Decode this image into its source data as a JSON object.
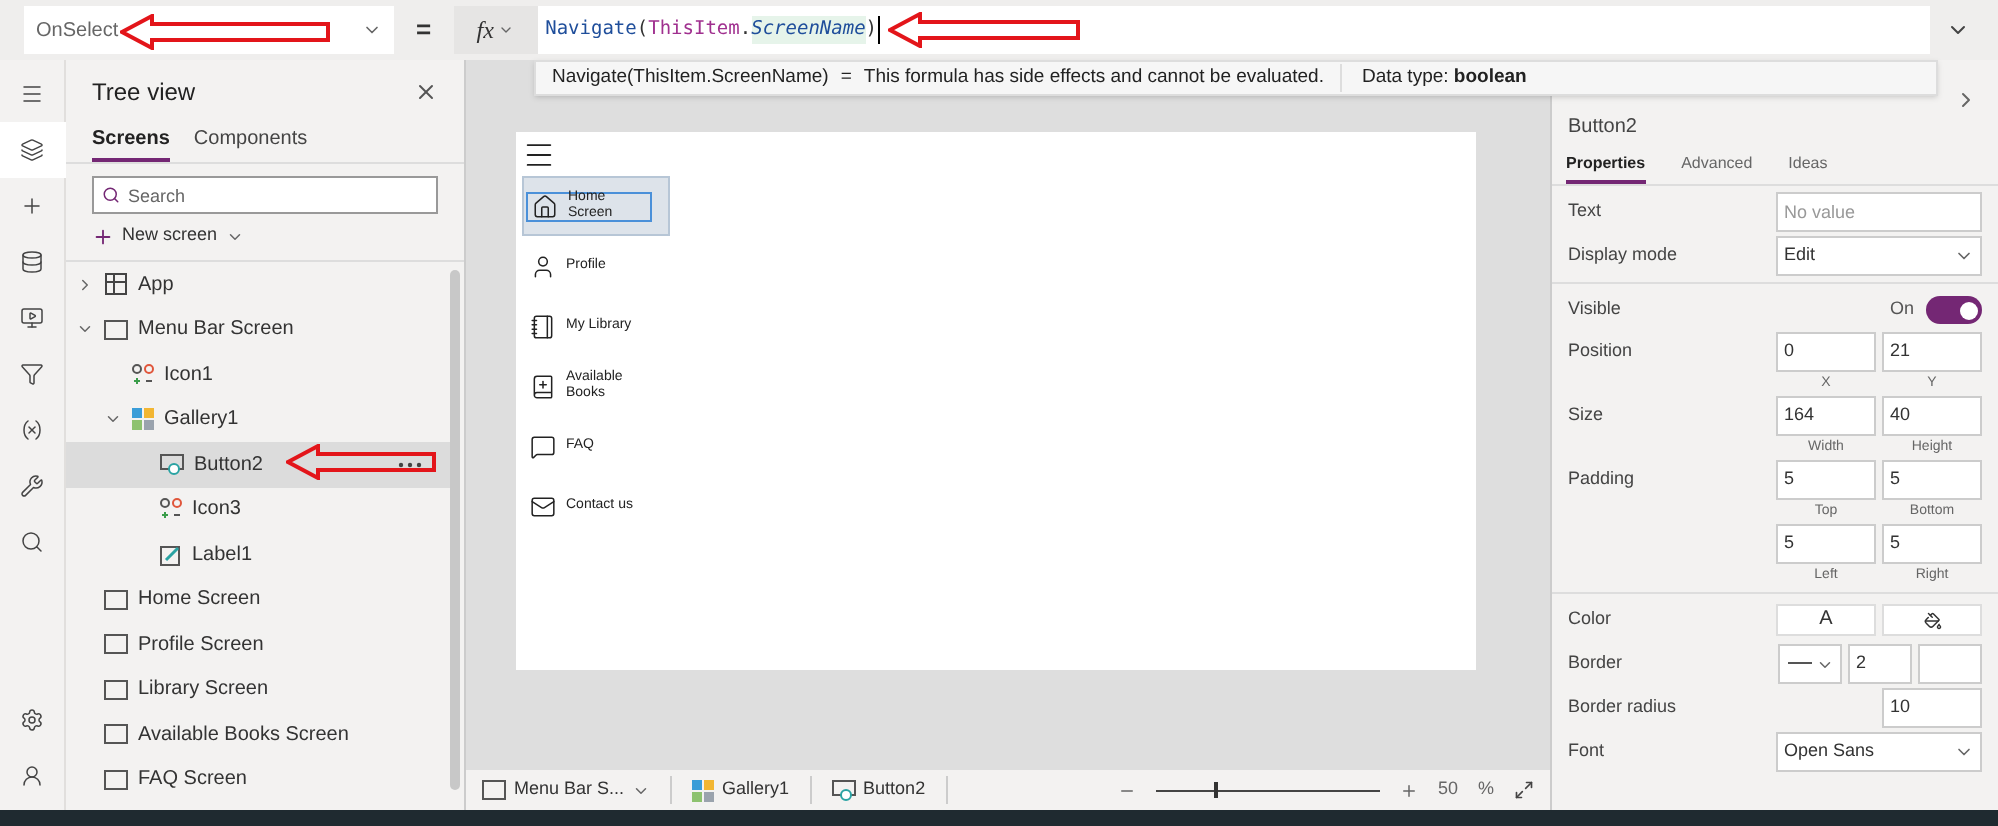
{
  "formula_bar": {
    "property": "OnSelect",
    "equals": "=",
    "fx": "fx",
    "tokens": [
      {
        "text": "Navigate",
        "kind": "function"
      },
      {
        "text": "(",
        "kind": "paren"
      },
      {
        "text": "ThisItem",
        "kind": "keyword"
      },
      {
        "text": ".",
        "kind": "plain"
      },
      {
        "text": "ScreenName",
        "kind": "property"
      },
      {
        "text": ")",
        "kind": "paren"
      }
    ]
  },
  "formula_tooltip": {
    "expression": "Navigate(ThisItem.ScreenName)",
    "equals": "=",
    "message": "This formula has side effects and cannot be evaluated.",
    "data_type": "Data type: **boolean**"
  },
  "rail": [
    {
      "kind": "menu",
      "selected": false
    },
    {
      "kind": "layers",
      "selected": true
    },
    {
      "kind": "insert",
      "selected": false
    },
    {
      "kind": "data",
      "selected": false
    },
    {
      "kind": "media",
      "selected": false
    },
    {
      "kind": "power",
      "selected": false
    },
    {
      "kind": "variables",
      "selected": false
    },
    {
      "kind": "tools",
      "selected": false
    },
    {
      "kind": "search",
      "selected": false
    }
  ],
  "rail_bottom": [
    {
      "kind": "settings",
      "selected": false
    },
    {
      "kind": "account",
      "selected": false
    }
  ],
  "tree_view": {
    "title": "Tree view",
    "tabs": [
      {
        "label": "Screens",
        "selected": true
      },
      {
        "label": "Components",
        "selected": false
      }
    ],
    "search": {
      "placeholder": "Search"
    },
    "new_screen": "New screen",
    "nodes": [
      {
        "label": "App",
        "kind": "app",
        "expanded": false,
        "selected": false
      },
      {
        "label": "Menu Bar Screen",
        "kind": "screen",
        "expanded": true,
        "selected": false,
        "children": [
          {
            "label": "Icon1",
            "kind": "icon",
            "selected": false
          },
          {
            "label": "Gallery1",
            "kind": "gallery",
            "expanded": true,
            "selected": false,
            "children": [
              {
                "label": "Button2",
                "kind": "button",
                "selected": true
              },
              {
                "label": "Icon3",
                "kind": "icon",
                "selected": false
              },
              {
                "label": "Label1",
                "kind": "label",
                "selected": false
              }
            ]
          }
        ]
      },
      {
        "label": "Home Screen",
        "kind": "screen",
        "selected": false
      },
      {
        "label": "Profile Screen",
        "kind": "screen",
        "selected": false
      },
      {
        "label": "Library Screen",
        "kind": "screen",
        "selected": false
      },
      {
        "label": "Available Books Screen",
        "kind": "screen",
        "selected": false
      },
      {
        "label": "FAQ Screen",
        "kind": "screen",
        "selected": false
      }
    ]
  },
  "app_screen": {
    "gallery": [
      {
        "label": "Home Screen",
        "kind": "home",
        "selected": true
      },
      {
        "label": "Profile",
        "kind": "person",
        "selected": false
      },
      {
        "label": "My Library",
        "kind": "notebook",
        "selected": false
      },
      {
        "label": "Available Books",
        "kind": "book",
        "selected": false
      },
      {
        "label": "FAQ",
        "kind": "chat",
        "selected": false
      },
      {
        "label": "Contact us",
        "kind": "mail",
        "selected": false
      }
    ]
  },
  "status_bar": {
    "breadcrumb": [
      {
        "label": "Menu Bar S...",
        "kind": "screen"
      },
      {
        "label": "Gallery1",
        "kind": "gallery"
      },
      {
        "label": "Button2",
        "kind": "button"
      }
    ],
    "zoom": {
      "level": 0.26,
      "reading": "50",
      "unit": "%"
    }
  },
  "properties_panel": {
    "control_name": "Button2",
    "tabs": [
      {
        "label": "Properties",
        "selected": true
      },
      {
        "label": "Advanced",
        "selected": false
      },
      {
        "label": "Ideas",
        "selected": false
      }
    ],
    "sections": [
      [
        {
          "kind": "text",
          "label": "Text",
          "placeholder": "No value"
        },
        {
          "kind": "dropdown",
          "label": "Display mode",
          "value": "Edit"
        }
      ],
      [
        {
          "kind": "toggle",
          "label": "Visible",
          "state_label": "On",
          "on": true
        },
        {
          "kind": "fields",
          "label": "Position",
          "fields": [
            {
              "value": "0",
              "caption": "X"
            },
            {
              "value": "21",
              "caption": "Y"
            }
          ]
        },
        {
          "kind": "fields",
          "label": "Size",
          "fields": [
            {
              "value": "164",
              "caption": "Width"
            },
            {
              "value": "40",
              "caption": "Height"
            }
          ]
        },
        {
          "kind": "fields",
          "label": "Padding",
          "fields": [
            {
              "value": "5",
              "caption": "Top"
            },
            {
              "value": "5",
              "caption": "Bottom"
            },
            {
              "value": "5",
              "caption": "Left"
            },
            {
              "value": "5",
              "caption": "Right"
            }
          ]
        }
      ],
      [
        {
          "kind": "color",
          "label": "Color",
          "glyph": "A"
        },
        {
          "kind": "border",
          "label": "Border",
          "value": "2"
        },
        {
          "kind": "number",
          "label": "Border radius",
          "value": "10"
        },
        {
          "kind": "dropdown",
          "label": "Font",
          "value": "Open Sans"
        }
      ]
    ]
  }
}
